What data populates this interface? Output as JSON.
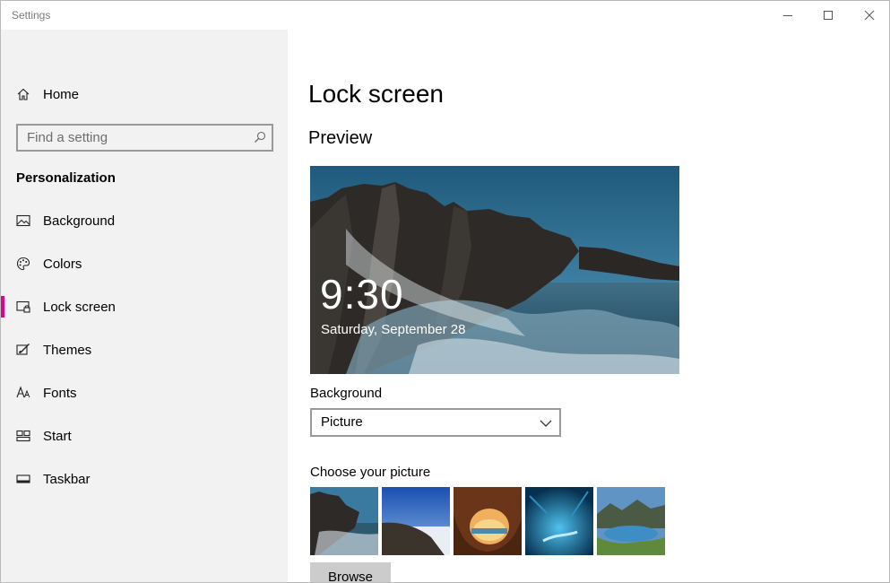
{
  "window": {
    "title": "Settings"
  },
  "title_buttons": {
    "minimize": "minimize-icon",
    "maximize": "maximize-icon",
    "close": "close-icon"
  },
  "sidebar": {
    "home_label": "Home",
    "search_placeholder": "Find a setting",
    "section_label": "Personalization",
    "accent_color": "#e3008c",
    "items": [
      {
        "label": "Background",
        "icon": "picture-icon"
      },
      {
        "label": "Colors",
        "icon": "palette-icon"
      },
      {
        "label": "Lock screen",
        "icon": "lock-screen-icon",
        "selected": true
      },
      {
        "label": "Themes",
        "icon": "themes-icon"
      },
      {
        "label": "Fonts",
        "icon": "fonts-icon"
      },
      {
        "label": "Start",
        "icon": "start-icon"
      },
      {
        "label": "Taskbar",
        "icon": "taskbar-icon"
      }
    ]
  },
  "main": {
    "title": "Lock screen",
    "preview_heading": "Preview",
    "preview": {
      "time": "9:30",
      "date": "Saturday, September 28"
    },
    "background_label": "Background",
    "background_value": "Picture",
    "choose_label": "Choose your picture",
    "thumbnails": [
      "rocky-coast-thumbnail",
      "snowy-hill-thumbnail",
      "sea-cave-sunset-thumbnail",
      "ice-cave-thumbnail",
      "mountain-lake-thumbnail"
    ],
    "browse_label": "Browse"
  }
}
